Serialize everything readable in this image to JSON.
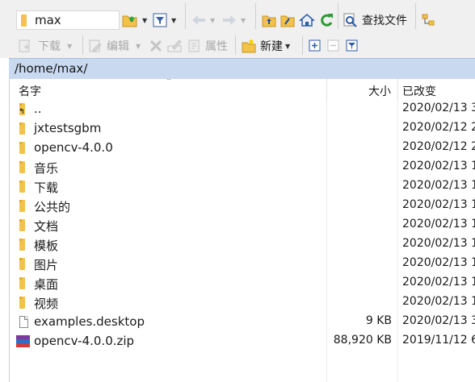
{
  "toolbar_top": {
    "location_value": "max",
    "find_files_label": "查找文件"
  },
  "toolbar_bottom": {
    "download_label": "下载",
    "edit_label": "编辑",
    "properties_label": "属性",
    "new_label": "新建"
  },
  "path": "/home/max/",
  "columns": {
    "name": "名字",
    "size": "大小",
    "modified": "已改变"
  },
  "files": [
    {
      "name": "..",
      "size": "",
      "modified": "2020/02/13 3",
      "icon": "parent-folder-icon"
    },
    {
      "name": "jxtestsgbm",
      "size": "",
      "modified": "2020/02/12 2",
      "icon": "folder-icon"
    },
    {
      "name": "opencv-4.0.0",
      "size": "",
      "modified": "2020/02/12 2",
      "icon": "folder-icon"
    },
    {
      "name": "音乐",
      "size": "",
      "modified": "2020/02/13 1",
      "icon": "folder-icon"
    },
    {
      "name": "下载",
      "size": "",
      "modified": "2020/02/13 1",
      "icon": "folder-icon"
    },
    {
      "name": "公共的",
      "size": "",
      "modified": "2020/02/13 1",
      "icon": "folder-icon"
    },
    {
      "name": "文档",
      "size": "",
      "modified": "2020/02/13 1",
      "icon": "folder-icon"
    },
    {
      "name": "模板",
      "size": "",
      "modified": "2020/02/13 1",
      "icon": "folder-icon"
    },
    {
      "name": "图片",
      "size": "",
      "modified": "2020/02/13 1",
      "icon": "folder-icon"
    },
    {
      "name": "桌面",
      "size": "",
      "modified": "2020/02/13 1",
      "icon": "folder-icon"
    },
    {
      "name": "视频",
      "size": "",
      "modified": "2020/02/13 1",
      "icon": "folder-icon"
    },
    {
      "name": "examples.desktop",
      "size": "9 KB",
      "modified": "2020/02/13 3",
      "icon": "file-icon"
    },
    {
      "name": "opencv-4.0.0.zip",
      "size": "88,920 KB",
      "modified": "2019/11/12 6",
      "icon": "zip-archive-icon"
    }
  ],
  "colors": {
    "path_bar": "#c9daf0",
    "toolbar": "#f0f0f0",
    "folder": "#f2c24b"
  }
}
